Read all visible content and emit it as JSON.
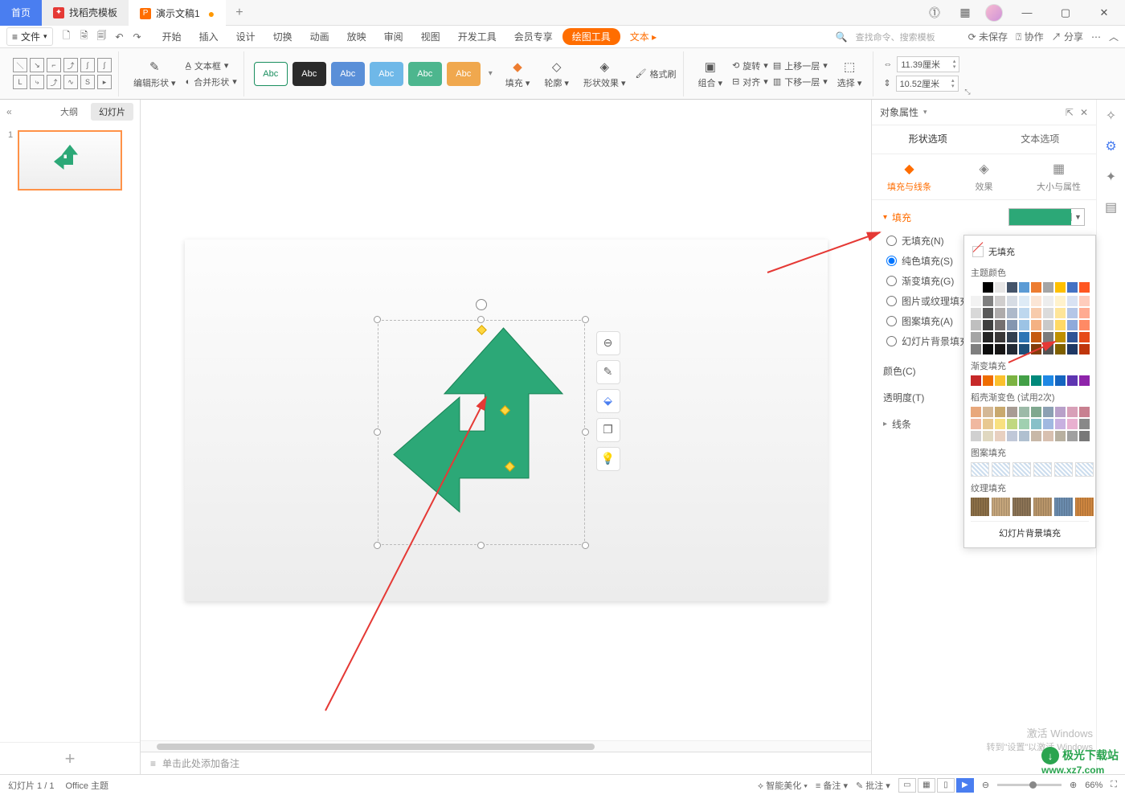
{
  "titlebar": {
    "home": "首页",
    "doc1": "找稻壳模板",
    "doc2": "演示文稿1",
    "modified_marker": "●"
  },
  "menubar": {
    "file": "文件",
    "items": [
      "开始",
      "插入",
      "设计",
      "切换",
      "动画",
      "放映",
      "审阅",
      "视图",
      "开发工具",
      "会员专享"
    ],
    "context_tool": "绘图工具",
    "text_tool": "文本",
    "search_placeholder": "查找命令、搜索模板",
    "unsaved": "未保存",
    "collab": "协作",
    "share": "分享"
  },
  "ribbon": {
    "edit_shape": "编辑形状",
    "textbox": "文本框",
    "merge_shapes": "合并形状",
    "style_label": "Abc",
    "fill": "填充",
    "outline": "轮廓",
    "shape_effects": "形状效果",
    "format_painter": "格式刷",
    "group": "组合",
    "rotate": "旋转",
    "align": "对齐",
    "bring_forward": "上移一层",
    "send_backward": "下移一层",
    "select": "选择",
    "width_icon_val": "11.39厘米",
    "height_icon_val": "10.52厘米"
  },
  "outline": {
    "collapse": "«",
    "tabs": [
      "大纲",
      "幻灯片"
    ],
    "slide_num": "1"
  },
  "notes": {
    "placeholder": "单击此处添加备注"
  },
  "prop": {
    "title": "对象属性",
    "tabs": [
      "形状选项",
      "文本选项"
    ],
    "subtabs": [
      "填充与线条",
      "效果",
      "大小与属性"
    ],
    "section_fill": "填充",
    "fill_options": {
      "none": "无填充(N)",
      "solid": "纯色填充(S)",
      "gradient": "渐变填充(G)",
      "picture": "图片或纹理填充",
      "pattern": "图案填充(A)",
      "slidebg": "幻灯片背景填充"
    },
    "color": "颜色(C)",
    "transparency": "透明度(T)",
    "section_line": "线条"
  },
  "colorpicker": {
    "no_fill": "无填充",
    "theme_colors": "主题颜色",
    "gradient_fill": "渐变填充",
    "preset_gradient": "稻壳渐变色 (试用2次)",
    "pattern_fill": "图案填充",
    "texture_fill": "纹理填充",
    "slide_bg_fill": "幻灯片背景填充",
    "theme_row1": [
      "#ffffff",
      "#000000",
      "#e7e6e6",
      "#44546a",
      "#5b9bd5",
      "#ed7d31",
      "#a5a5a5",
      "#ffc000",
      "#4472c4",
      "#ff5722"
    ],
    "theme_shades": [
      [
        "#f2f2f2",
        "#7f7f7f",
        "#d0cece",
        "#d6dce4",
        "#deebf6",
        "#fbe5d5",
        "#ededed",
        "#fff2cc",
        "#d9e2f3",
        "#ffccbc"
      ],
      [
        "#d8d8d8",
        "#595959",
        "#aeabab",
        "#adb9ca",
        "#bdd7ee",
        "#f7cbac",
        "#dbdbdb",
        "#fee599",
        "#b4c6e7",
        "#ffab91"
      ],
      [
        "#bfbfbf",
        "#3f3f3f",
        "#757070",
        "#8496b0",
        "#9cc3e5",
        "#f4b183",
        "#c9c9c9",
        "#ffd965",
        "#8eaadb",
        "#ff8a65"
      ],
      [
        "#a5a5a5",
        "#262626",
        "#3a3838",
        "#323f4f",
        "#2e75b5",
        "#c55a11",
        "#7b7b7b",
        "#bf9000",
        "#2f5496",
        "#e64a19"
      ],
      [
        "#7f7f7f",
        "#0c0c0c",
        "#171616",
        "#222a35",
        "#1e4e79",
        "#833c0b",
        "#525252",
        "#7f6000",
        "#1f3864",
        "#bf360c"
      ]
    ],
    "grad_row": [
      "#c62828",
      "#ef6c00",
      "#fbc02d",
      "#7cb342",
      "#43a047",
      "#00897b",
      "#1e88e5",
      "#1565c0",
      "#5e35b1",
      "#8e24aa"
    ],
    "preset_rows": [
      [
        "#e8a87c",
        "#d4b896",
        "#c9a96e",
        "#a89c94",
        "#9cbaa8",
        "#7fa88f",
        "#8ca0b3",
        "#b8a0c9",
        "#d8a0b8",
        "#c88090"
      ],
      [
        "#f0b8a0",
        "#e8c890",
        "#f8e080",
        "#c0d880",
        "#a0d0b0",
        "#88c0c8",
        "#a0b8e0",
        "#c8b0e0",
        "#e8b0d0",
        "#888888"
      ],
      [
        "#d0d0d0",
        "#e0d8c0",
        "#e8d0c0",
        "#c0c8d8",
        "#b0c0d0",
        "#c8b8a8",
        "#d8c0b0",
        "#b8b0a0",
        "#a0a0a0",
        "#787878"
      ]
    ],
    "textures": [
      "#8b6f47",
      "#c4a57b",
      "#8b7355",
      "#b8956a",
      "#6b8cae",
      "#cd853f"
    ]
  },
  "statusbar": {
    "slide_info": "幻灯片 1 / 1",
    "theme": "Office 主题",
    "beautify": "智能美化",
    "notes": "备注",
    "comments": "批注",
    "zoom": "66%"
  },
  "watermark": {
    "win1": "激活 Windows",
    "win2": "转到\"设置\"以激活 Windows",
    "site1": "极光下载站",
    "site2": "www.xz7.com"
  }
}
